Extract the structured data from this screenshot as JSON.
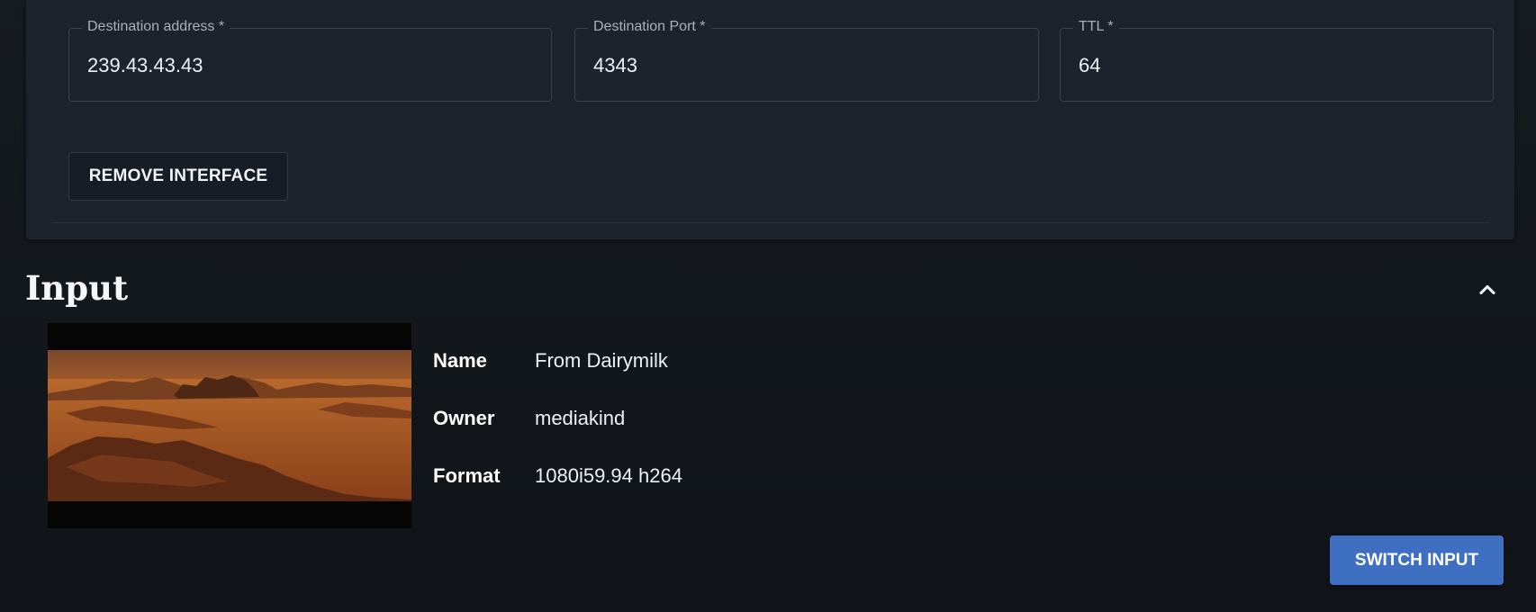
{
  "interface": {
    "fields": [
      {
        "label": "Destination address *",
        "value": "239.43.43.43"
      },
      {
        "label": "Destination Port *",
        "value": "4343"
      },
      {
        "label": "TTL *",
        "value": "64"
      }
    ],
    "remove_button_label": "REMOVE INTERFACE"
  },
  "input_section": {
    "title": "Input",
    "collapse_icon": "chevron-up-icon",
    "details": [
      {
        "key": "Name",
        "value": "From Dairymilk"
      },
      {
        "key": "Owner",
        "value": "mediakind"
      },
      {
        "key": "Format",
        "value": "1080i59.94 h264"
      }
    ],
    "switch_button_label": "SWITCH INPUT"
  },
  "colors": {
    "accent": "#3f6fc0",
    "card_background": "#1c232d",
    "page_background": "#12161b"
  }
}
